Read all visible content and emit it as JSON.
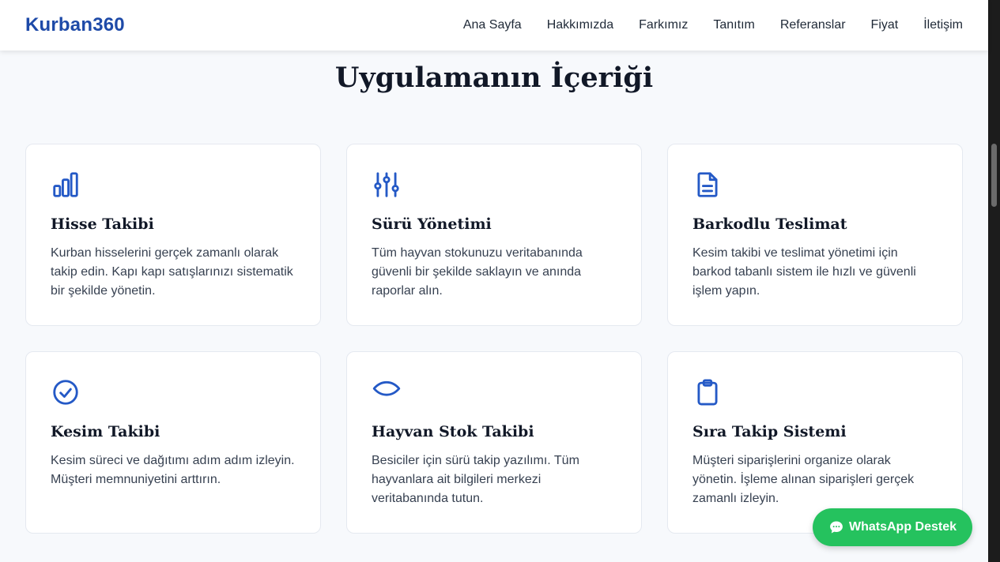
{
  "brand": "Kurban360",
  "nav": [
    "Ana Sayfa",
    "Hakkımızda",
    "Farkımız",
    "Tanıtım",
    "Referanslar",
    "Fiyat",
    "İletişim"
  ],
  "section_title": "Uygulamanın İçeriği",
  "cards": [
    {
      "icon": "bar-chart-icon",
      "title": "Hisse Takibi",
      "text": "Kurban hisselerini gerçek zamanlı olarak takip edin. Kapı kapı satışlarınızı sistematik bir şekilde yönetin."
    },
    {
      "icon": "sliders-icon",
      "title": "Sürü Yönetimi",
      "text": "Tüm hayvan stokunuzu veritabanında güvenli bir şekilde saklayın ve anında raporlar alın."
    },
    {
      "icon": "document-icon",
      "title": "Barkodlu Teslimat",
      "text": "Kesim takibi ve teslimat yönetimi için barkod tabanlı sistem ile hızlı ve güvenli işlem yapın."
    },
    {
      "icon": "check-circle-icon",
      "title": "Kesim Takibi",
      "text": "Kesim süreci ve dağıtımı adım adım izleyin. Müşteri memnuniyetini arttırın."
    },
    {
      "icon": "eye-icon",
      "title": "Hayvan Stok Takibi",
      "text": "Besiciler için sürü takip yazılımı. Tüm hayvanlara ait bilgileri merkezi veritabanında tutun."
    },
    {
      "icon": "clipboard-icon",
      "title": "Sıra Takip Sistemi",
      "text": "Müşteri siparişlerini organize olarak yönetin. İşleme alınan siparişleri gerçek zamanlı izleyin."
    }
  ],
  "whatsapp_label": "WhatsApp Destek",
  "colors": {
    "brand": "#1e4aa8",
    "icon": "#2459c6",
    "whatsapp": "#25c25e"
  }
}
